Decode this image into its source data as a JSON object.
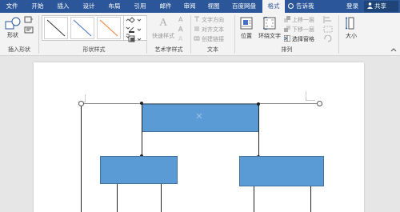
{
  "tabs": [
    "文件",
    "开始",
    "插入",
    "设计",
    "布局",
    "引用",
    "邮件",
    "审阅",
    "视图",
    "百度网盘",
    "格式"
  ],
  "active_tab": "格式",
  "tell_me": "告诉我",
  "login": "登录",
  "share": "共享",
  "ribbon": {
    "insert_shapes": {
      "shapes_label": "形状",
      "group_label": "插入形状"
    },
    "shape_styles": {
      "group_label": "形状样式"
    },
    "wordart": {
      "quick_styles": "快速样式",
      "group_label": "艺术字样式"
    },
    "text": {
      "direction": "文字方向",
      "align": "对齐文本",
      "link": "创建链接",
      "group_label": "文本"
    },
    "arrange": {
      "position": "位置",
      "wrap": "环绕文字",
      "forward": "上移一层",
      "backward": "下移一层",
      "selection_pane": "选择窗格",
      "group_label": "排列"
    },
    "size": {
      "label": "大小"
    }
  },
  "colors": {
    "brand": "#2b579a",
    "shape_fill": "#5b9bd5",
    "shape_border": "#41719c"
  }
}
